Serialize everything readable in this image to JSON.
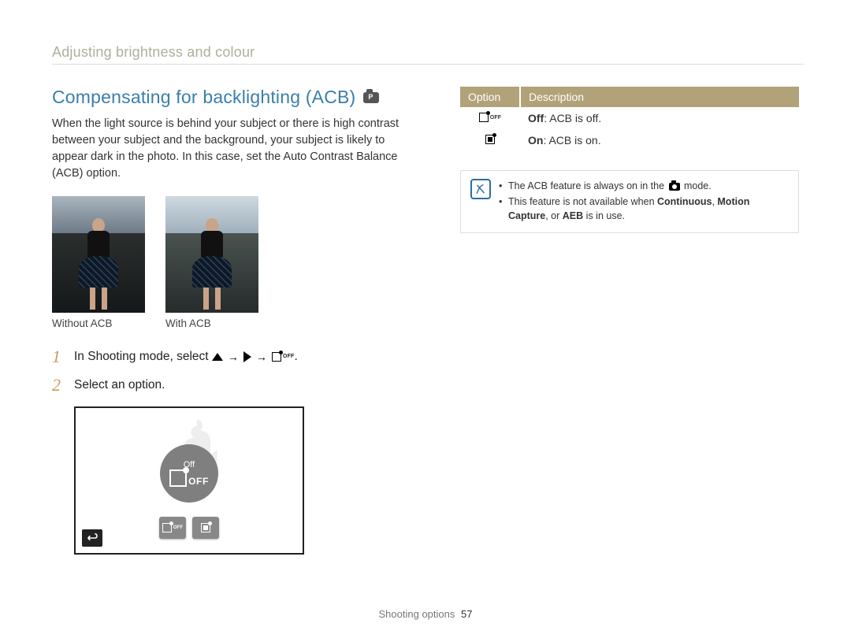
{
  "section_title": "Adjusting brightness and colour",
  "heading": "Compensating for backlighting (ACB)",
  "intro": "When the light source is behind your subject or there is high contrast between your subject and the background, your subject is likely to appear dark in the photo. In this case, set the Auto Contrast Balance (ACB) option.",
  "photos": {
    "without_caption": "Without ACB",
    "with_caption": "With ACB"
  },
  "steps": {
    "s1_prefix": "In Shooting mode, select",
    "s1_suffix": ".",
    "s2": "Select an option."
  },
  "screen": {
    "off_label": "Off",
    "big_off": "OFF"
  },
  "options_table": {
    "head_option": "Option",
    "head_description": "Description",
    "rows": [
      {
        "bold": "Off",
        "rest": ": ACB is off.",
        "icon": "off"
      },
      {
        "bold": "On",
        "rest": ": ACB is on.",
        "icon": "on"
      }
    ]
  },
  "notes": {
    "line1_a": "The ACB feature is always on in the ",
    "line1_b": " mode.",
    "line2_a": "This feature is not available when ",
    "line2_b1": "Continuous",
    "line2_sep1": ", ",
    "line2_b2": "Motion Capture",
    "line2_sep2": ", or ",
    "line2_b3": "AEB",
    "line2_c": " is in use."
  },
  "footer": {
    "label": "Shooting options",
    "page": "57"
  }
}
